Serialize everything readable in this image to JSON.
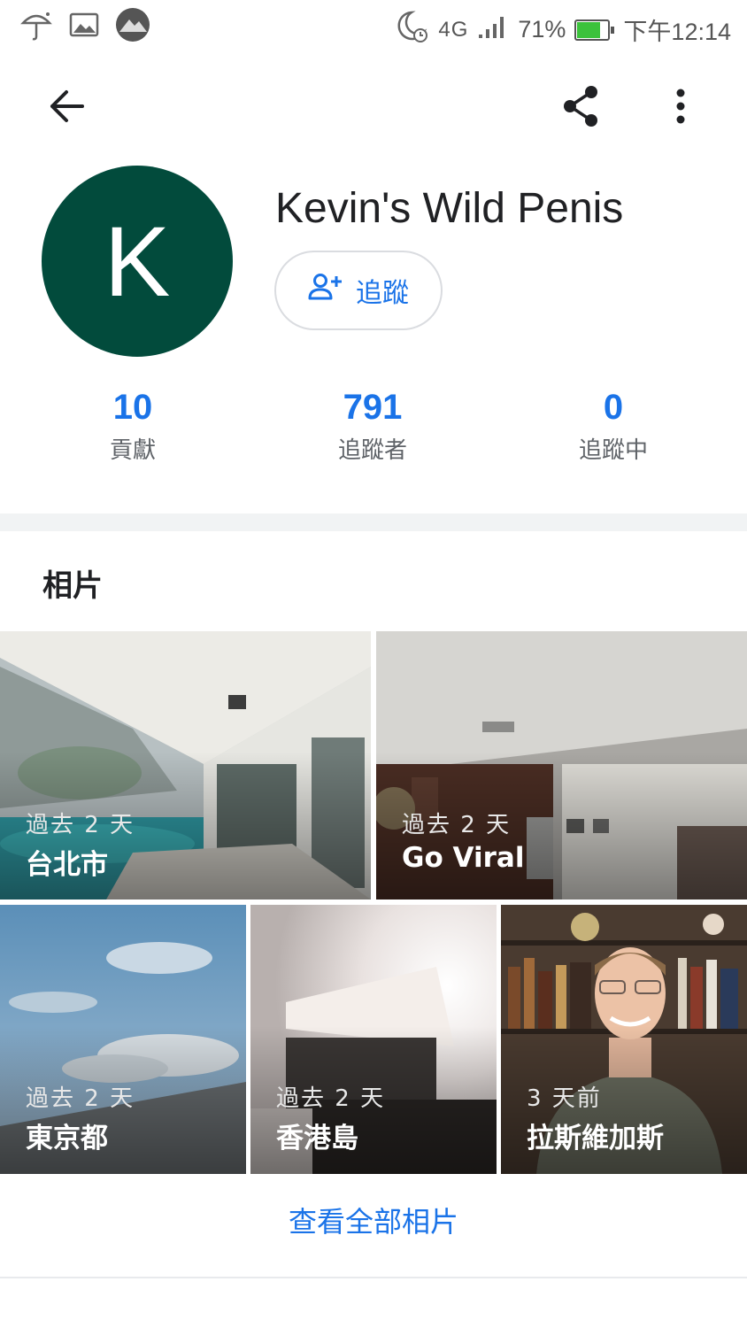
{
  "status_bar": {
    "network": "4G",
    "battery_percent": "71%",
    "battery_level": 0.71,
    "time": "下午12:14",
    "icons": [
      "umbrella-icon",
      "image-icon",
      "mountain-app-icon",
      "moon-alarm-icon",
      "signal-icon",
      "battery-charging-icon"
    ]
  },
  "app_bar": {
    "icons": [
      "back-arrow-icon",
      "share-icon",
      "more-vert-icon"
    ]
  },
  "profile": {
    "avatar_letter": "K",
    "avatar_color": "#024b3c",
    "name": "Kevin's Wild Penis",
    "follow_label": "追蹤"
  },
  "stats": [
    {
      "value": "10",
      "label": "貢獻"
    },
    {
      "value": "791",
      "label": "追蹤者"
    },
    {
      "value": "0",
      "label": "追蹤中"
    }
  ],
  "photos": {
    "title": "相片",
    "items": [
      {
        "time": "過去 2 天",
        "place": "台北市"
      },
      {
        "time": "過去 2 天",
        "place": "Go Viral"
      },
      {
        "time": "過去 2 天",
        "place": "東京都"
      },
      {
        "time": "過去 2 天",
        "place": "香港島"
      },
      {
        "time": "3 天前",
        "place": "拉斯維加斯"
      }
    ],
    "view_all_label": "查看全部相片"
  },
  "colors": {
    "accent": "#1a73e8",
    "text_primary": "#202124",
    "text_secondary": "#5f6368"
  }
}
